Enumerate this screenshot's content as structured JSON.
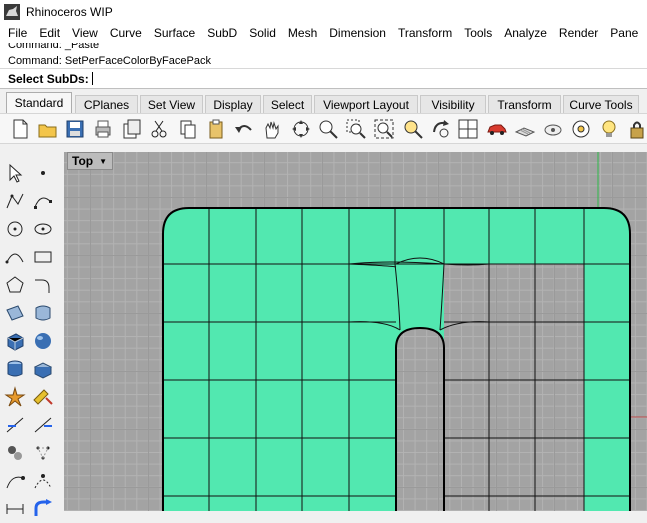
{
  "window": {
    "title": "Rhinoceros WIP"
  },
  "menu": [
    "File",
    "Edit",
    "View",
    "Curve",
    "Surface",
    "SubD",
    "Solid",
    "Mesh",
    "Dimension",
    "Transform",
    "Tools",
    "Analyze",
    "Render",
    "Pane"
  ],
  "command_history": [
    "Command: _Paste",
    "Command: SetPerFaceColorByFacePack"
  ],
  "command_prompt": {
    "label": "Select SubDs:",
    "value": ""
  },
  "tabs": [
    {
      "label": "Standard",
      "active": true
    },
    {
      "label": "CPlanes"
    },
    {
      "label": "Set View"
    },
    {
      "label": "Display"
    },
    {
      "label": "Select"
    },
    {
      "label": "Viewport Layout"
    },
    {
      "label": "Visibility"
    },
    {
      "label": "Transform"
    },
    {
      "label": "Curve Tools"
    }
  ],
  "toolbar_icons": [
    "new-icon",
    "open-icon",
    "save-icon",
    "print-icon",
    "import-icon",
    "cut-icon",
    "copy-icon",
    "paste-icon",
    "undo-icon",
    "pan-icon",
    "rotate-view-icon",
    "zoom-dynamic-icon",
    "zoom-window-icon",
    "zoom-extents-icon",
    "zoom-selected-icon",
    "rotate-icon",
    "four-viewports-icon",
    "car-icon",
    "named-cplane-icon",
    "cplane-icon",
    "osnap-icon",
    "light-icon",
    "lock-icon"
  ],
  "left_toolbar_icons": [
    "select-icon",
    "point-icon",
    "polyline-icon",
    "curve-icon",
    "circle-icon",
    "ellipse-icon",
    "arc-icon",
    "rectangle-icon",
    "polygon-icon",
    "fillet-curve-icon",
    "surface-icon",
    "loft-icon",
    "box-icon",
    "sphere-icon",
    "cylinder-icon",
    "extrude-icon",
    "explode-icon",
    "boolean-icon",
    "trim-icon",
    "split-icon",
    "group-icon",
    "points-icon",
    "curve-tools-icon",
    "edit-points-icon",
    "dimension-icon",
    "transform-icon"
  ],
  "viewport": {
    "title": "Top",
    "surface_color": "#52e8b0"
  }
}
